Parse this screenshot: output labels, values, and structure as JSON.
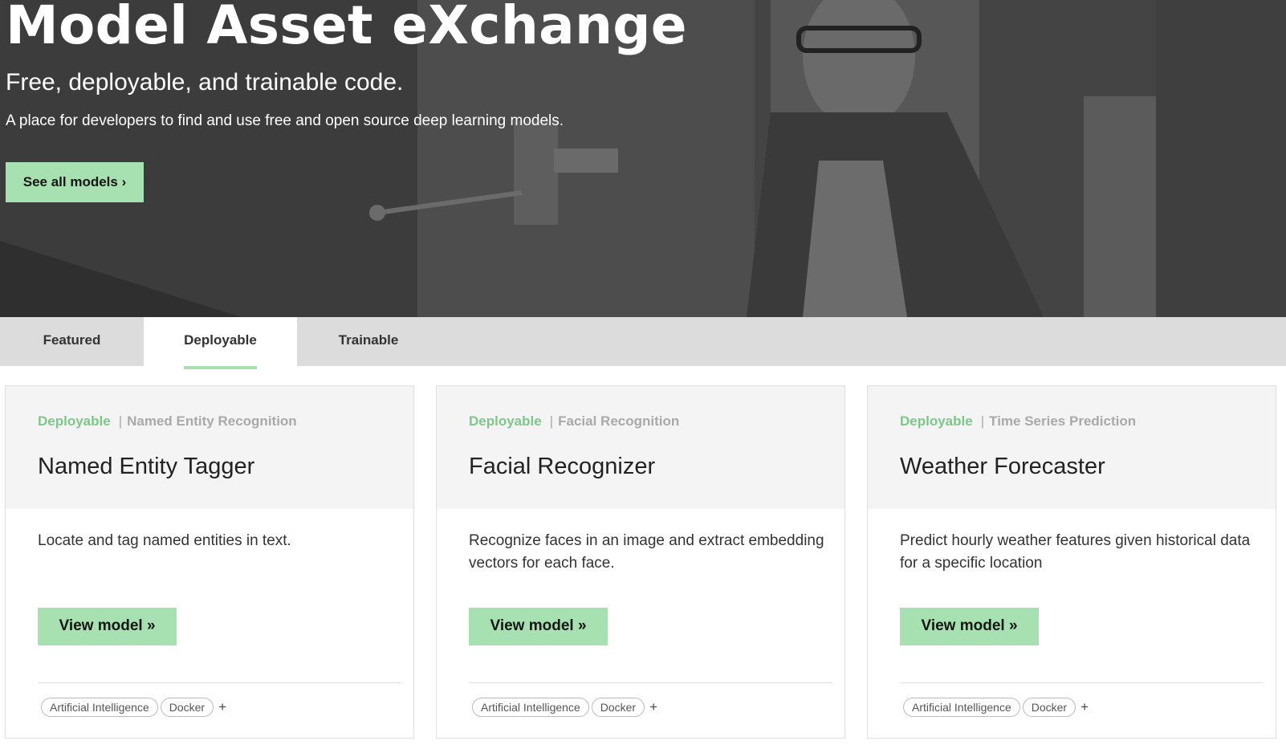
{
  "hero": {
    "title": "Model Asset eXchange",
    "subtitle": "Free, deployable, and trainable code.",
    "description": "A place for developers to find and use free and open source deep learning models.",
    "cta_label": "See all models ›"
  },
  "tabs": [
    {
      "label": "Featured",
      "active": false
    },
    {
      "label": "Deployable",
      "active": true
    },
    {
      "label": "Trainable",
      "active": false
    }
  ],
  "cards": [
    {
      "category": "Deployable",
      "separator": "|",
      "topic": "Named Entity Recognition",
      "title": "Named Entity Tagger",
      "description": "Locate and tag named entities in text.",
      "button_label": "View model »",
      "pills": [
        "Artificial Intelligence",
        "Docker"
      ],
      "more": "+"
    },
    {
      "category": "Deployable",
      "separator": "|",
      "topic": "Facial Recognition",
      "title": "Facial Recognizer",
      "description": "Recognize faces in an image and extract embedding vectors for each face.",
      "button_label": "View model »",
      "pills": [
        "Artificial Intelligence",
        "Docker"
      ],
      "more": "+"
    },
    {
      "category": "Deployable",
      "separator": "|",
      "topic": "Time Series Prediction",
      "title": "Weather Forecaster",
      "description": "Predict hourly weather features given historical data for a specific location",
      "button_label": "View model »",
      "pills": [
        "Artificial Intelligence",
        "Docker"
      ],
      "more": "+"
    }
  ],
  "colors": {
    "accent": "#a7e0b1",
    "category_text": "#7ec78a",
    "tab_bar": "#dcdcdc"
  }
}
